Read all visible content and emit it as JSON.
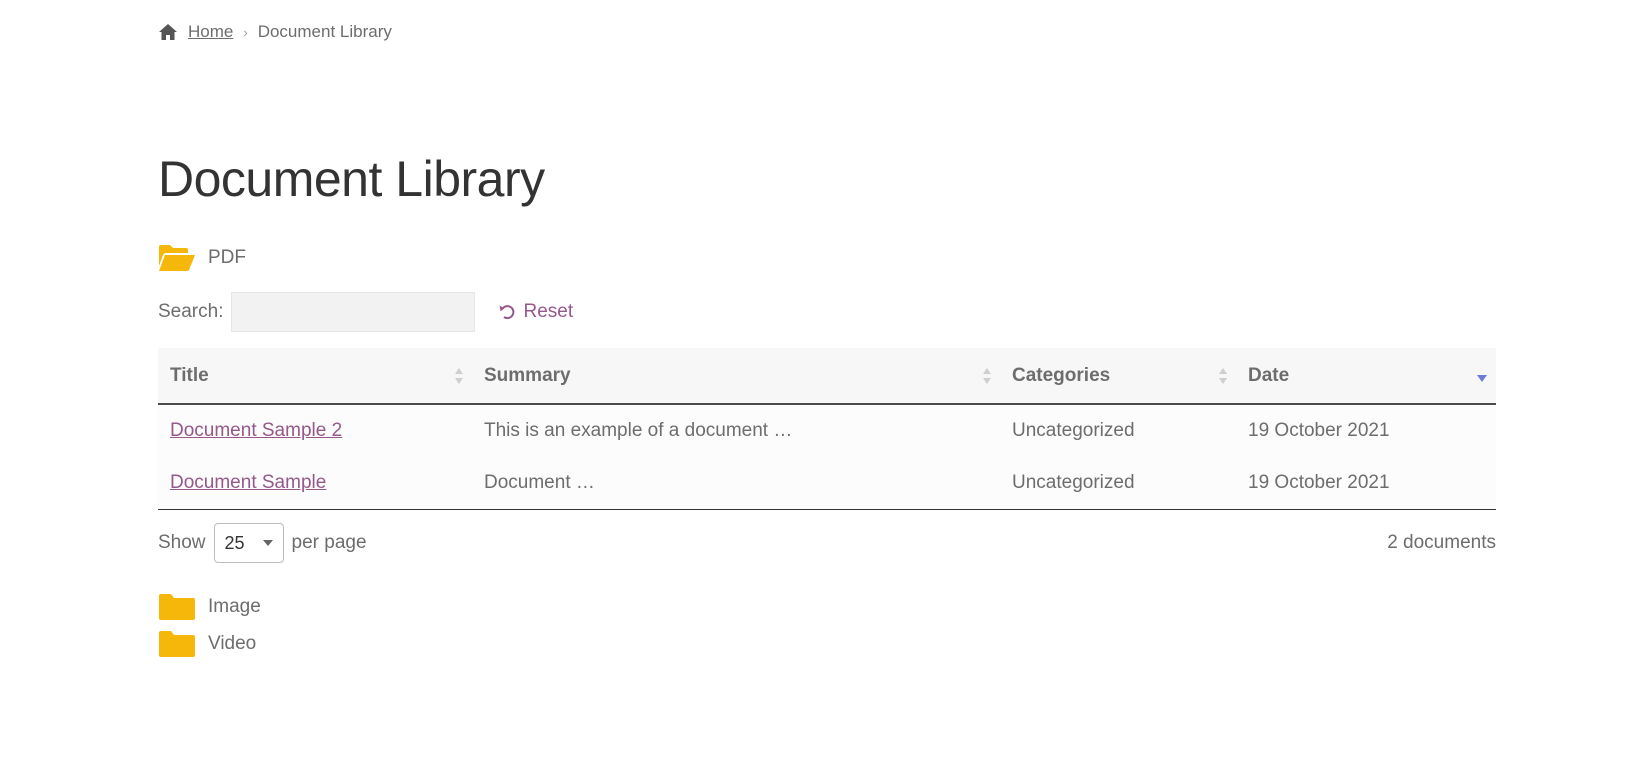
{
  "breadcrumb": {
    "home_label": "Home",
    "current_label": "Document Library"
  },
  "page": {
    "title": "Document Library"
  },
  "folders": {
    "pdf": "PDF",
    "image": "Image",
    "video": "Video"
  },
  "search": {
    "label": "Search:",
    "value": "",
    "reset_label": "Reset"
  },
  "table": {
    "headers": {
      "title": "Title",
      "summary": "Summary",
      "categories": "Categories",
      "date": "Date"
    },
    "rows": [
      {
        "title": "Document Sample 2",
        "summary": "This is an example of a document …",
        "categories": "Uncategorized",
        "date": "19 October 2021"
      },
      {
        "title": "Document Sample",
        "summary": "Document …",
        "categories": "Uncategorized",
        "date": "19 October 2021"
      }
    ]
  },
  "footer": {
    "show_label": "Show",
    "per_page_value": "25",
    "per_page_label": "per page",
    "count_label": "2 documents"
  },
  "colors": {
    "link": "#96588a",
    "folder": "#f4b70a",
    "sort_active": "#6b7bd6",
    "text": "#6d6d6d"
  }
}
